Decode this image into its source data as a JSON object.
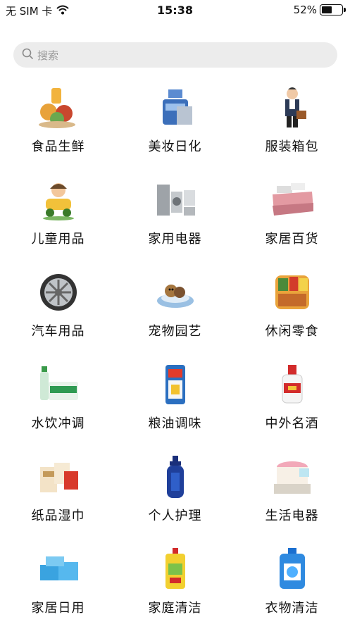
{
  "status": {
    "carrier": "无 SIM 卡",
    "time": "15:38",
    "battery_text": "52%",
    "battery_level": 0.52
  },
  "search": {
    "placeholder": "搜索"
  },
  "categories": [
    {
      "label": "食品生鲜",
      "icon": "fresh-food-icon"
    },
    {
      "label": "美妆日化",
      "icon": "cosmetics-icon"
    },
    {
      "label": "服装箱包",
      "icon": "apparel-bags-icon"
    },
    {
      "label": "儿童用品",
      "icon": "kids-products-icon"
    },
    {
      "label": "家用电器",
      "icon": "home-appliances-icon"
    },
    {
      "label": "家居百货",
      "icon": "home-goods-icon"
    },
    {
      "label": "汽车用品",
      "icon": "auto-products-icon"
    },
    {
      "label": "宠物园艺",
      "icon": "pet-garden-icon"
    },
    {
      "label": "休闲零食",
      "icon": "snacks-icon"
    },
    {
      "label": "水饮冲调",
      "icon": "drinks-icon"
    },
    {
      "label": "粮油调味",
      "icon": "grain-oil-icon"
    },
    {
      "label": "中外名酒",
      "icon": "liquor-icon"
    },
    {
      "label": "纸品湿巾",
      "icon": "paper-wipes-icon"
    },
    {
      "label": "个人护理",
      "icon": "personal-care-icon"
    },
    {
      "label": "生活电器",
      "icon": "small-appliances-icon"
    },
    {
      "label": "家居日用",
      "icon": "household-daily-icon"
    },
    {
      "label": "家庭清洁",
      "icon": "home-cleaning-icon"
    },
    {
      "label": "衣物清洁",
      "icon": "laundry-icon"
    }
  ]
}
